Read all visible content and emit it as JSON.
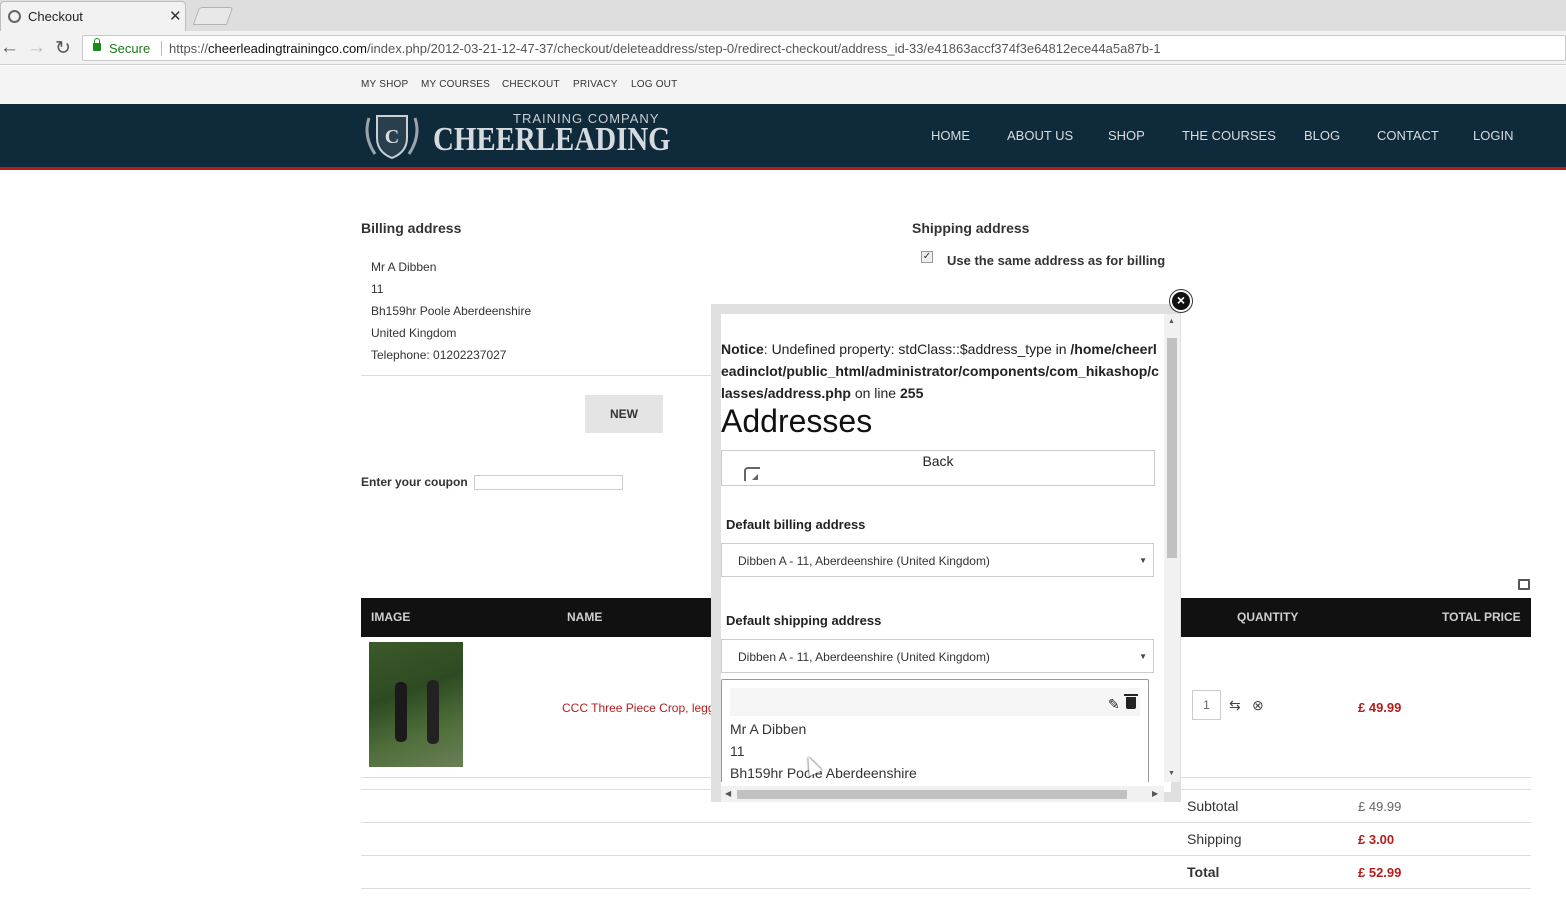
{
  "browser": {
    "tab_title": "Checkout",
    "secure_label": "Secure",
    "url_scheme": "https://",
    "url_domain": "cheerleadingtrainingco.com",
    "url_path": "/index.php/2012-03-21-12-47-37/checkout/deleteaddress/step-0/redirect-checkout/address_id-33/e41863accf374f3e64812ece44a5a87b-1"
  },
  "topnav": [
    "MY SHOP",
    "MY COURSES",
    "CHECKOUT",
    "PRIVACY",
    "LOG OUT"
  ],
  "logo": {
    "small": "TRAINING COMPANY",
    "big": "CHEERLEADING"
  },
  "mainnav": [
    "HOME",
    "ABOUT US",
    "SHOP",
    "THE COURSES",
    "BLOG",
    "CONTACT",
    "LOGIN"
  ],
  "billing": {
    "title": "Billing address",
    "lines": [
      "Mr A Dibben",
      "11",
      "Bh159hr Poole Aberdeenshire",
      "United Kingdom",
      "Telephone: 01202237027"
    ],
    "new_button": "NEW"
  },
  "shipping": {
    "title": "Shipping address",
    "same_label": "Use the same address as for billing",
    "same_checked": true
  },
  "coupon": {
    "label": "Enter your coupon",
    "value": ""
  },
  "cart": {
    "headers": [
      "IMAGE",
      "NAME",
      "QUANTITY",
      "TOTAL PRICE"
    ],
    "item": {
      "name": "CCC Three Piece Crop, legg",
      "qty": "1",
      "price": "£ 49.99"
    },
    "subtotal_label": "Subtotal",
    "subtotal": "£ 49.99",
    "shipping_label": "Shipping",
    "shipping": "£ 3.00",
    "total_label": "Total",
    "total": "£ 52.99"
  },
  "modal": {
    "close_symbol": "×",
    "notice_label": "Notice",
    "notice_text": ": Undefined property: stdClass::$address_type in ",
    "notice_path": "/home/cheerleadinclot/public_html/administrator/components/com_hikashop/classes/address.php",
    "notice_line_text": " on line ",
    "notice_line": "255",
    "title": "Addresses",
    "back_label": "Back",
    "billing_label": "Default billing address",
    "billing_value": "Dibben A - 11, Aberdeenshire (United Kingdom)",
    "shipping_label": "Default shipping address",
    "shipping_value": "Dibben A - 11, Aberdeenshire (United Kingdom)",
    "card_lines": [
      "Mr A Dibben",
      "11",
      "Bh159hr Poole Aberdeenshire"
    ]
  }
}
